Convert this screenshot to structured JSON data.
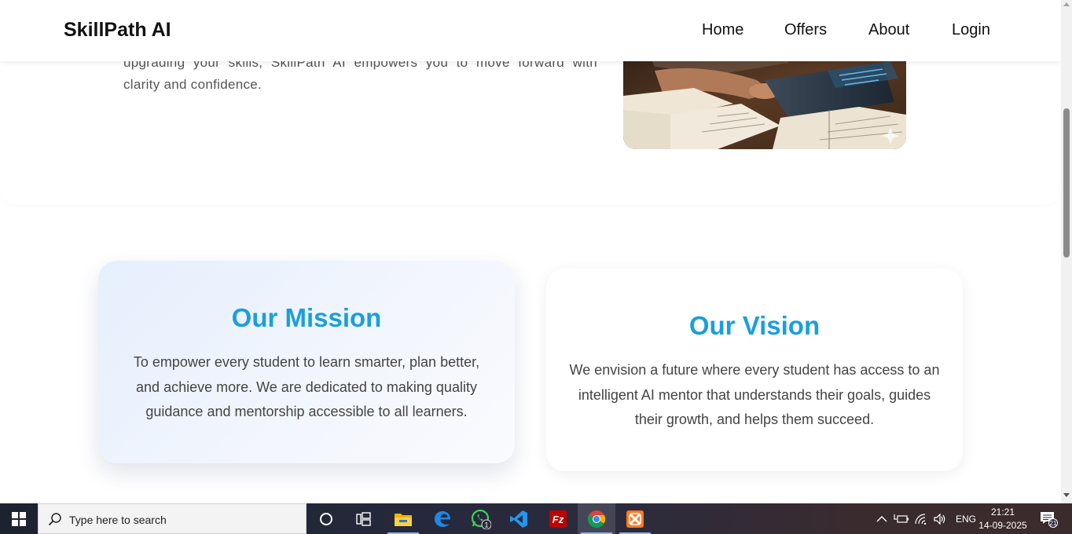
{
  "navbar": {
    "brand": "SkillPath AI",
    "links": [
      "Home",
      "Offers",
      "About",
      "Login"
    ]
  },
  "hero": {
    "text_line1": "upgrading your skills, SkillPath AI empowers you to move forward with",
    "text_line2": "clarity and confidence."
  },
  "mission": {
    "title": "Our Mission",
    "text": "To empower every student to learn smarter, plan better, and achieve more. We are dedicated to making quality guidance and mentorship accessible to all learners."
  },
  "vision": {
    "title": "Our Vision",
    "text": "We envision a future where every student has access to an intelligent AI mentor that understands their goals, guides their growth, and helps them succeed."
  },
  "taskbar": {
    "search_placeholder": "Type here to search",
    "apps": [
      "cortana-icon",
      "task-view-icon",
      "file-explorer-icon",
      "edge-icon",
      "whatsapp-icon",
      "vscode-icon",
      "filezilla-icon",
      "chrome-icon",
      "xampp-icon"
    ],
    "whatsapp_badge": "1",
    "language": "ENG",
    "time": "21:21",
    "date": "14-09-2025",
    "notification_count": "21"
  }
}
